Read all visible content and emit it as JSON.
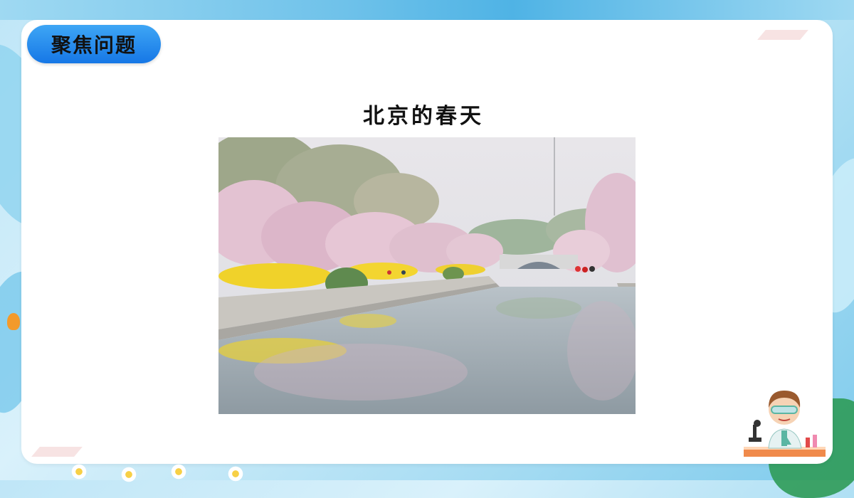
{
  "header": {
    "badge_label": "聚焦问题"
  },
  "main": {
    "title": "北京的春天"
  },
  "photo": {
    "description_name": "spring-canal-photo"
  },
  "colors": {
    "accent": "#1677e6",
    "card": "#ffffff",
    "background": "#bfe6f7"
  }
}
